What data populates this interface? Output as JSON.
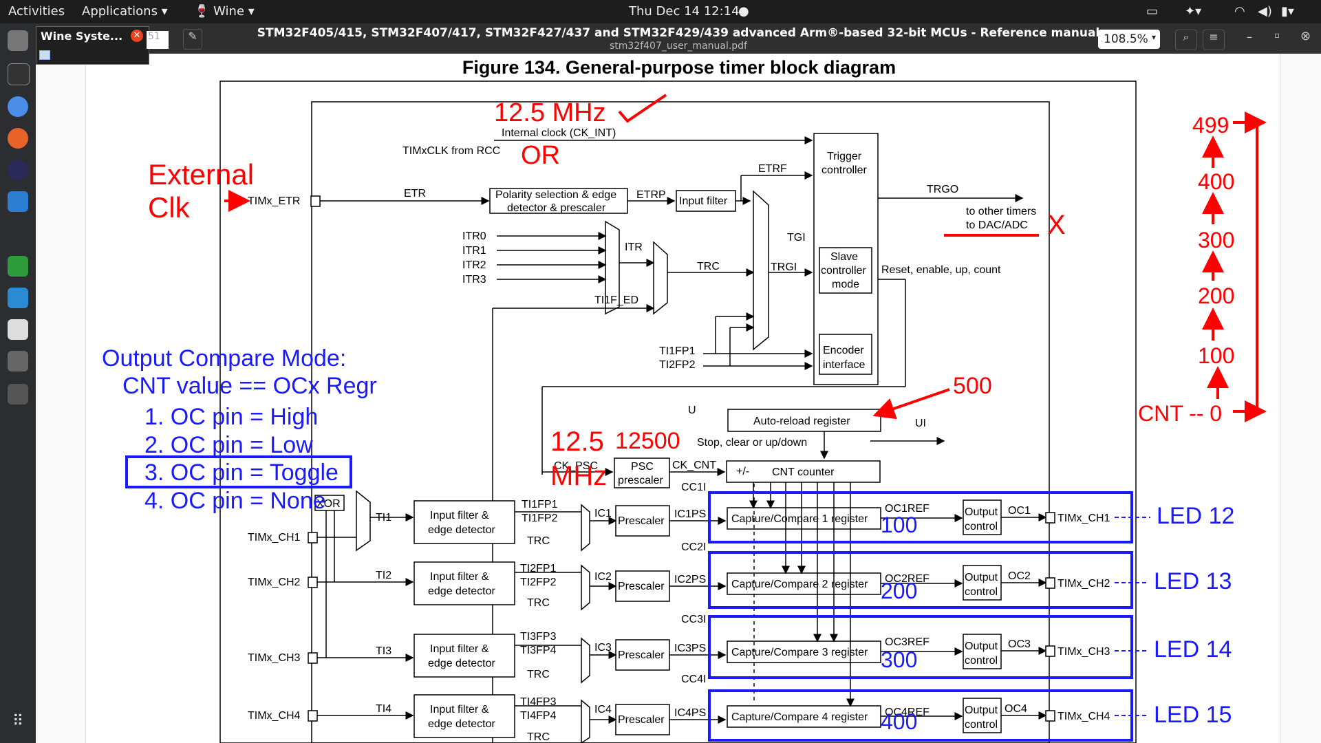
{
  "topbar": {
    "activities": "Activities",
    "applications": "Applications",
    "wine": "Wine",
    "clock": "Thu Dec 14  12:14"
  },
  "wine_tooltip": {
    "title": "Wine Syste...",
    "num": "51"
  },
  "window": {
    "title": "STM32F405/415, STM32F407/417, STM32F427/437 and STM32F429/439 advanced Arm®-based 32-bit MCUs - Reference manual",
    "subtitle": "stm32f407_user_manual.pdf",
    "zoom": "108.5%"
  },
  "figure": {
    "title": "Figure 134. General-purpose timer block diagram",
    "labels": {
      "internal_clock": "Internal clock (CK_INT)",
      "timxclk": "TIMxCLK from RCC",
      "timx_etr": "TIMx_ETR",
      "etr": "ETR",
      "polarity1": "Polarity selection & edge",
      "polarity2": "detector & prescaler",
      "etrp": "ETRP",
      "input_filter": "Input filter",
      "etrf": "ETRF",
      "trigger1": "Trigger",
      "trigger2": "controller",
      "trgo": "TRGO",
      "to_other": "to other timers",
      "to_dac": "to DAC/ADC",
      "itr0": "ITR0",
      "itr1": "ITR1",
      "itr2": "ITR2",
      "itr3": "ITR3",
      "itr": "ITR",
      "trc": "TRC",
      "tgi": "TGI",
      "trgi": "TRGI",
      "slave1": "Slave",
      "slave2": "controller",
      "slave3": "mode",
      "reset": "Reset, enable, up, count",
      "ti1f_ed": "TI1F_ED",
      "ti1fp1": "TI1FP1",
      "ti2fp2": "TI2FP2",
      "encoder1": "Encoder",
      "encoder2": "interface",
      "u": "U",
      "ui": "UI",
      "autoreload": "Auto-reload register",
      "stop_clear": "Stop, clear or up/down",
      "ck_psc": "CK_PSC",
      "psc1": "PSC",
      "psc2": "prescaler",
      "ck_cnt": "CK_CNT",
      "plusminus": "+/-",
      "cnt_counter": "CNT counter",
      "xor": "XOR",
      "ti1": "TI1",
      "ti2": "TI2",
      "ti3": "TI3",
      "ti4": "TI4",
      "timx_ch1": "TIMx_CH1",
      "timx_ch2": "TIMx_CH2",
      "timx_ch3": "TIMx_CH3",
      "timx_ch4": "TIMx_CH4",
      "if1": "Input filter &",
      "if2": "edge detector",
      "ti1fp1b": "TI1FP1",
      "ti1fp2": "TI1FP2",
      "ti2fp1": "TI2FP1",
      "ti2fp2b": "TI2FP2",
      "ti3fp3": "TI3FP3",
      "ti3fp4": "TI3FP4",
      "ti4fp3": "TI4FP3",
      "ti4fp4": "TI4FP4",
      "ic1": "IC1",
      "ic2": "IC2",
      "ic3": "IC3",
      "ic4": "IC4",
      "prescaler": "Prescaler",
      "ic1ps": "IC1PS",
      "ic2ps": "IC2PS",
      "ic3ps": "IC3PS",
      "ic4ps": "IC4PS",
      "cc1i": "CC1I",
      "cc2i": "CC2I",
      "cc3i": "CC3I",
      "cc4i": "CC4I",
      "cc1r": "Capture/Compare 1 register",
      "cc2r": "Capture/Compare 2 register",
      "cc3r": "Capture/Compare 3 register",
      "cc4r": "Capture/Compare 4 register",
      "oc1ref": "OC1REF",
      "oc2ref": "OC2REF",
      "oc3ref": "OC3REF",
      "oc4ref": "OC4REF",
      "out1": "Output",
      "out2": "control",
      "oc1": "OC1",
      "oc2": "OC2",
      "oc3": "OC3",
      "oc4": "OC4"
    }
  },
  "annotations": {
    "mhz_top": "12.5 MHz",
    "or": "OR",
    "external": "External",
    "clk": "Clk",
    "x_mark": "X",
    "n500": "500",
    "n125a": "12.5",
    "n12500": "12500",
    "mhz2": "MHz",
    "cmp1": "100",
    "cmp2": "200",
    "cmp3": "300",
    "cmp4": "400",
    "led12": "LED 12",
    "led13": "LED 13",
    "led14": "LED 14",
    "led15": "LED 15",
    "oc_title": "Output Compare Mode:",
    "oc_line1": "CNT value == OCx Regr",
    "oc_item1": "1. OC pin = High",
    "oc_item2": "2. OC pin = Low",
    "oc_item3": "3. OC pin = Toggle",
    "oc_item4": "4. OC pin = None",
    "cnt_scale": [
      "499",
      "400",
      "300",
      "200",
      "100"
    ],
    "cnt_zero": "CNT -- 0"
  },
  "colors": {
    "red": "#ff0000",
    "blue": "#1a1aff",
    "topbar": "#1d1d1d",
    "dock": "#2b2d31"
  }
}
